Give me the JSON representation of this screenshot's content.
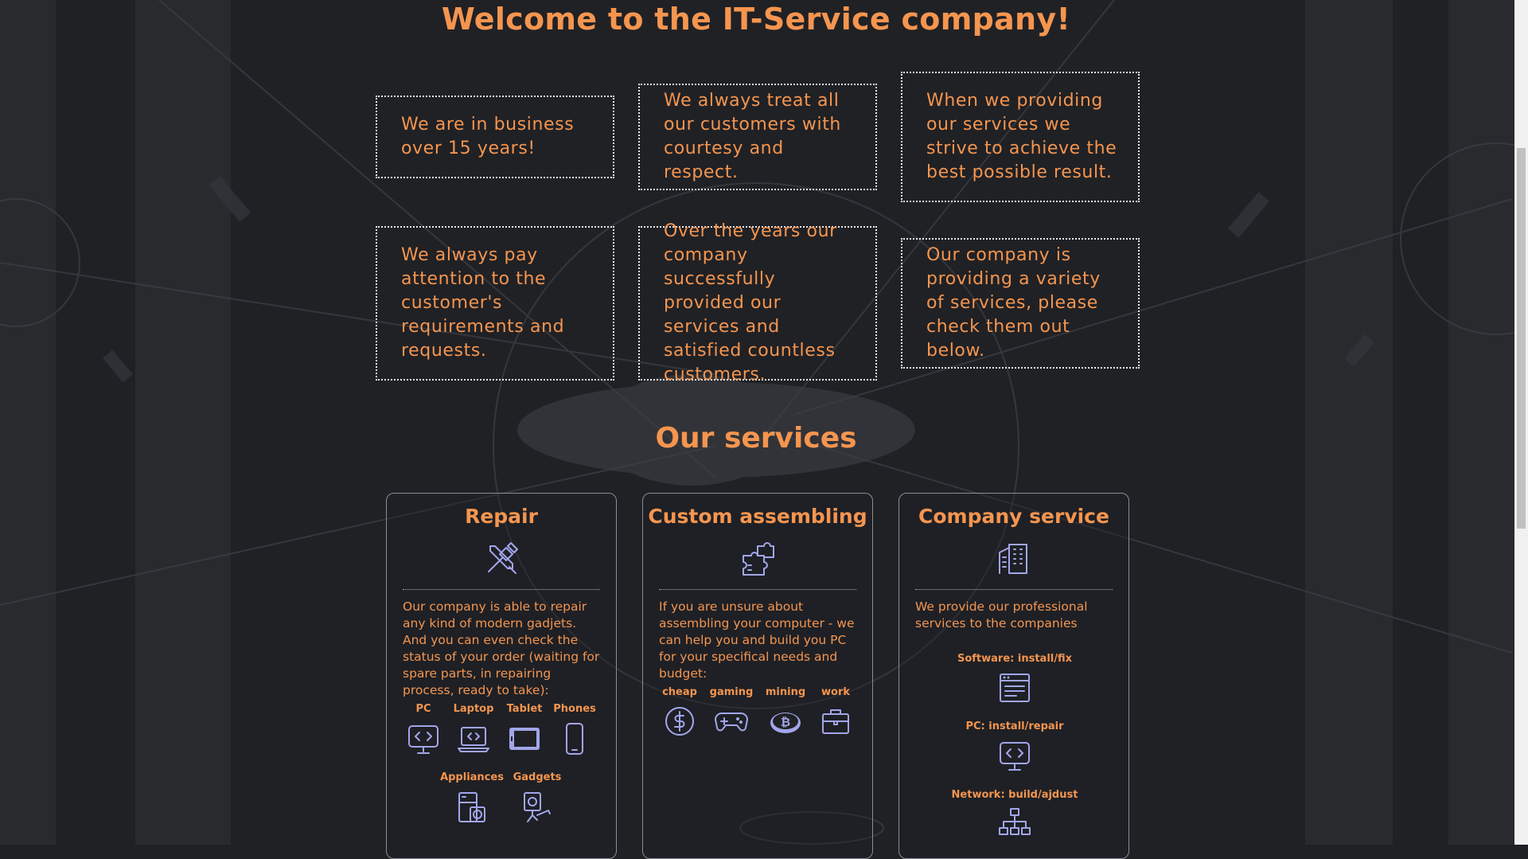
{
  "welcome": {
    "title": "Welcome to the IT-Service company!"
  },
  "features": [
    "We are in business over 15 years!",
    "We always treat all our customers with courtesy and respect.",
    "When we providing our services we strive to achieve the best possible result.",
    "We always pay attention to the customer's requirements and requests.",
    "Over the years our company successfully provided our services and satisfied countless customers.",
    "Our company is providing a variety of services, please check them out below."
  ],
  "services": {
    "title": "Our services",
    "repair": {
      "title": "Repair",
      "icon": "tools-icon",
      "description": "Our company is able to repair any kind of modern gadjets. And you can even check the status of your order (waiting for spare parts, in repairing process, ready to take):",
      "devices": [
        {
          "label": "PC",
          "icon": "monitor-code-icon"
        },
        {
          "label": "Laptop",
          "icon": "laptop-code-icon"
        },
        {
          "label": "Tablet",
          "icon": "tablet-icon"
        },
        {
          "label": "Phones",
          "icon": "phone-icon"
        },
        {
          "label": "Appliances",
          "icon": "appliances-icon"
        },
        {
          "label": "Gadgets",
          "icon": "security-camera-icon"
        }
      ]
    },
    "assembling": {
      "title": "Custom assembling",
      "icon": "puzzle-icon",
      "description": "If you are unsure about assembling your computer - we can help you and build you PC for your specifical needs and budget:",
      "options": [
        {
          "label": "cheap",
          "icon": "dollar-coin-icon"
        },
        {
          "label": "gaming",
          "icon": "gamepad-icon"
        },
        {
          "label": "mining",
          "icon": "bitcoin-icon"
        },
        {
          "label": "work",
          "icon": "briefcase-icon"
        }
      ]
    },
    "company": {
      "title": "Company service",
      "icon": "office-building-icon",
      "description": "We provide our professional services to the companies",
      "items": [
        {
          "label": "Software: install/fix",
          "icon": "software-window-icon"
        },
        {
          "label": "PC: install/repair",
          "icon": "monitor-code-icon"
        },
        {
          "label": "Network: build/ajdust",
          "icon": "network-icon"
        }
      ]
    }
  },
  "colors": {
    "accent": "#f5954f",
    "icon": "#a2a6ea",
    "background": "#202125",
    "border": "#e9e9ee"
  }
}
